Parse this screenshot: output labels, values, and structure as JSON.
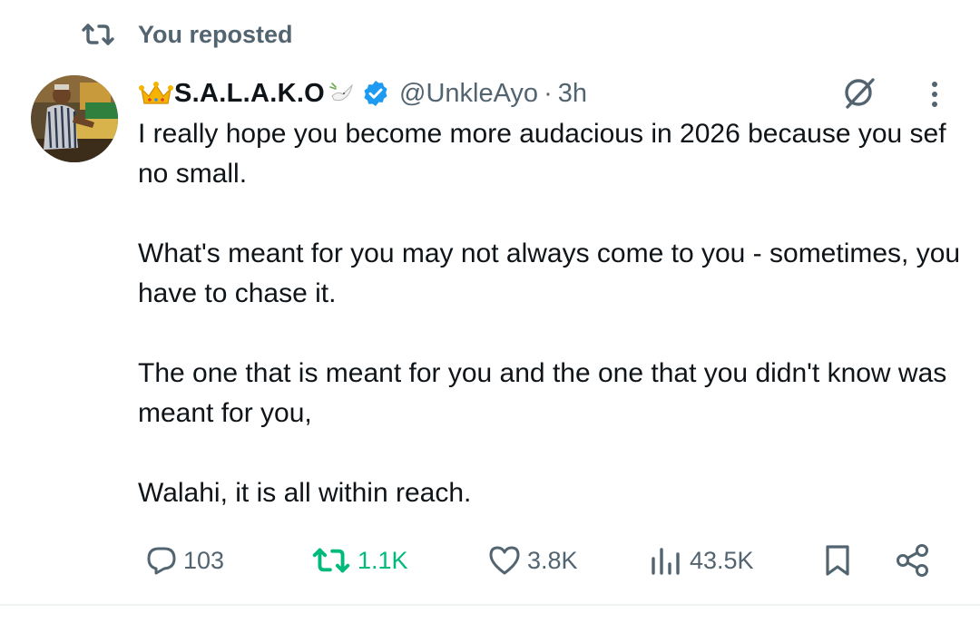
{
  "repost_banner": {
    "label": "You reposted",
    "icon": "repost-icon"
  },
  "post": {
    "author": {
      "display_name": "S.A.L.A.K.O",
      "handle": "@UnkleAyo",
      "verified": true,
      "name_emojis": [
        "crown-emoji",
        "dove-emoji"
      ]
    },
    "separator": "·",
    "time": "3h",
    "top_icons": [
      "grok-icon",
      "more-icon"
    ],
    "paragraphs": [
      "I really hope you become more audacious in 2026 because you sef no small.",
      "What's meant for you may not always come to you - sometimes, you have to chase it.",
      "The one that is meant for you and the one that you didn't know was meant for you,",
      "Walahi, it is all within reach."
    ],
    "actions": {
      "replies": "103",
      "reposts": "1.1K",
      "likes": "3.8K",
      "views": "43.5K"
    }
  },
  "colors": {
    "text": "#0f1419",
    "secondary": "#536471",
    "repost_active": "#00ba7c",
    "verified_badge": "#1d9bf0"
  }
}
